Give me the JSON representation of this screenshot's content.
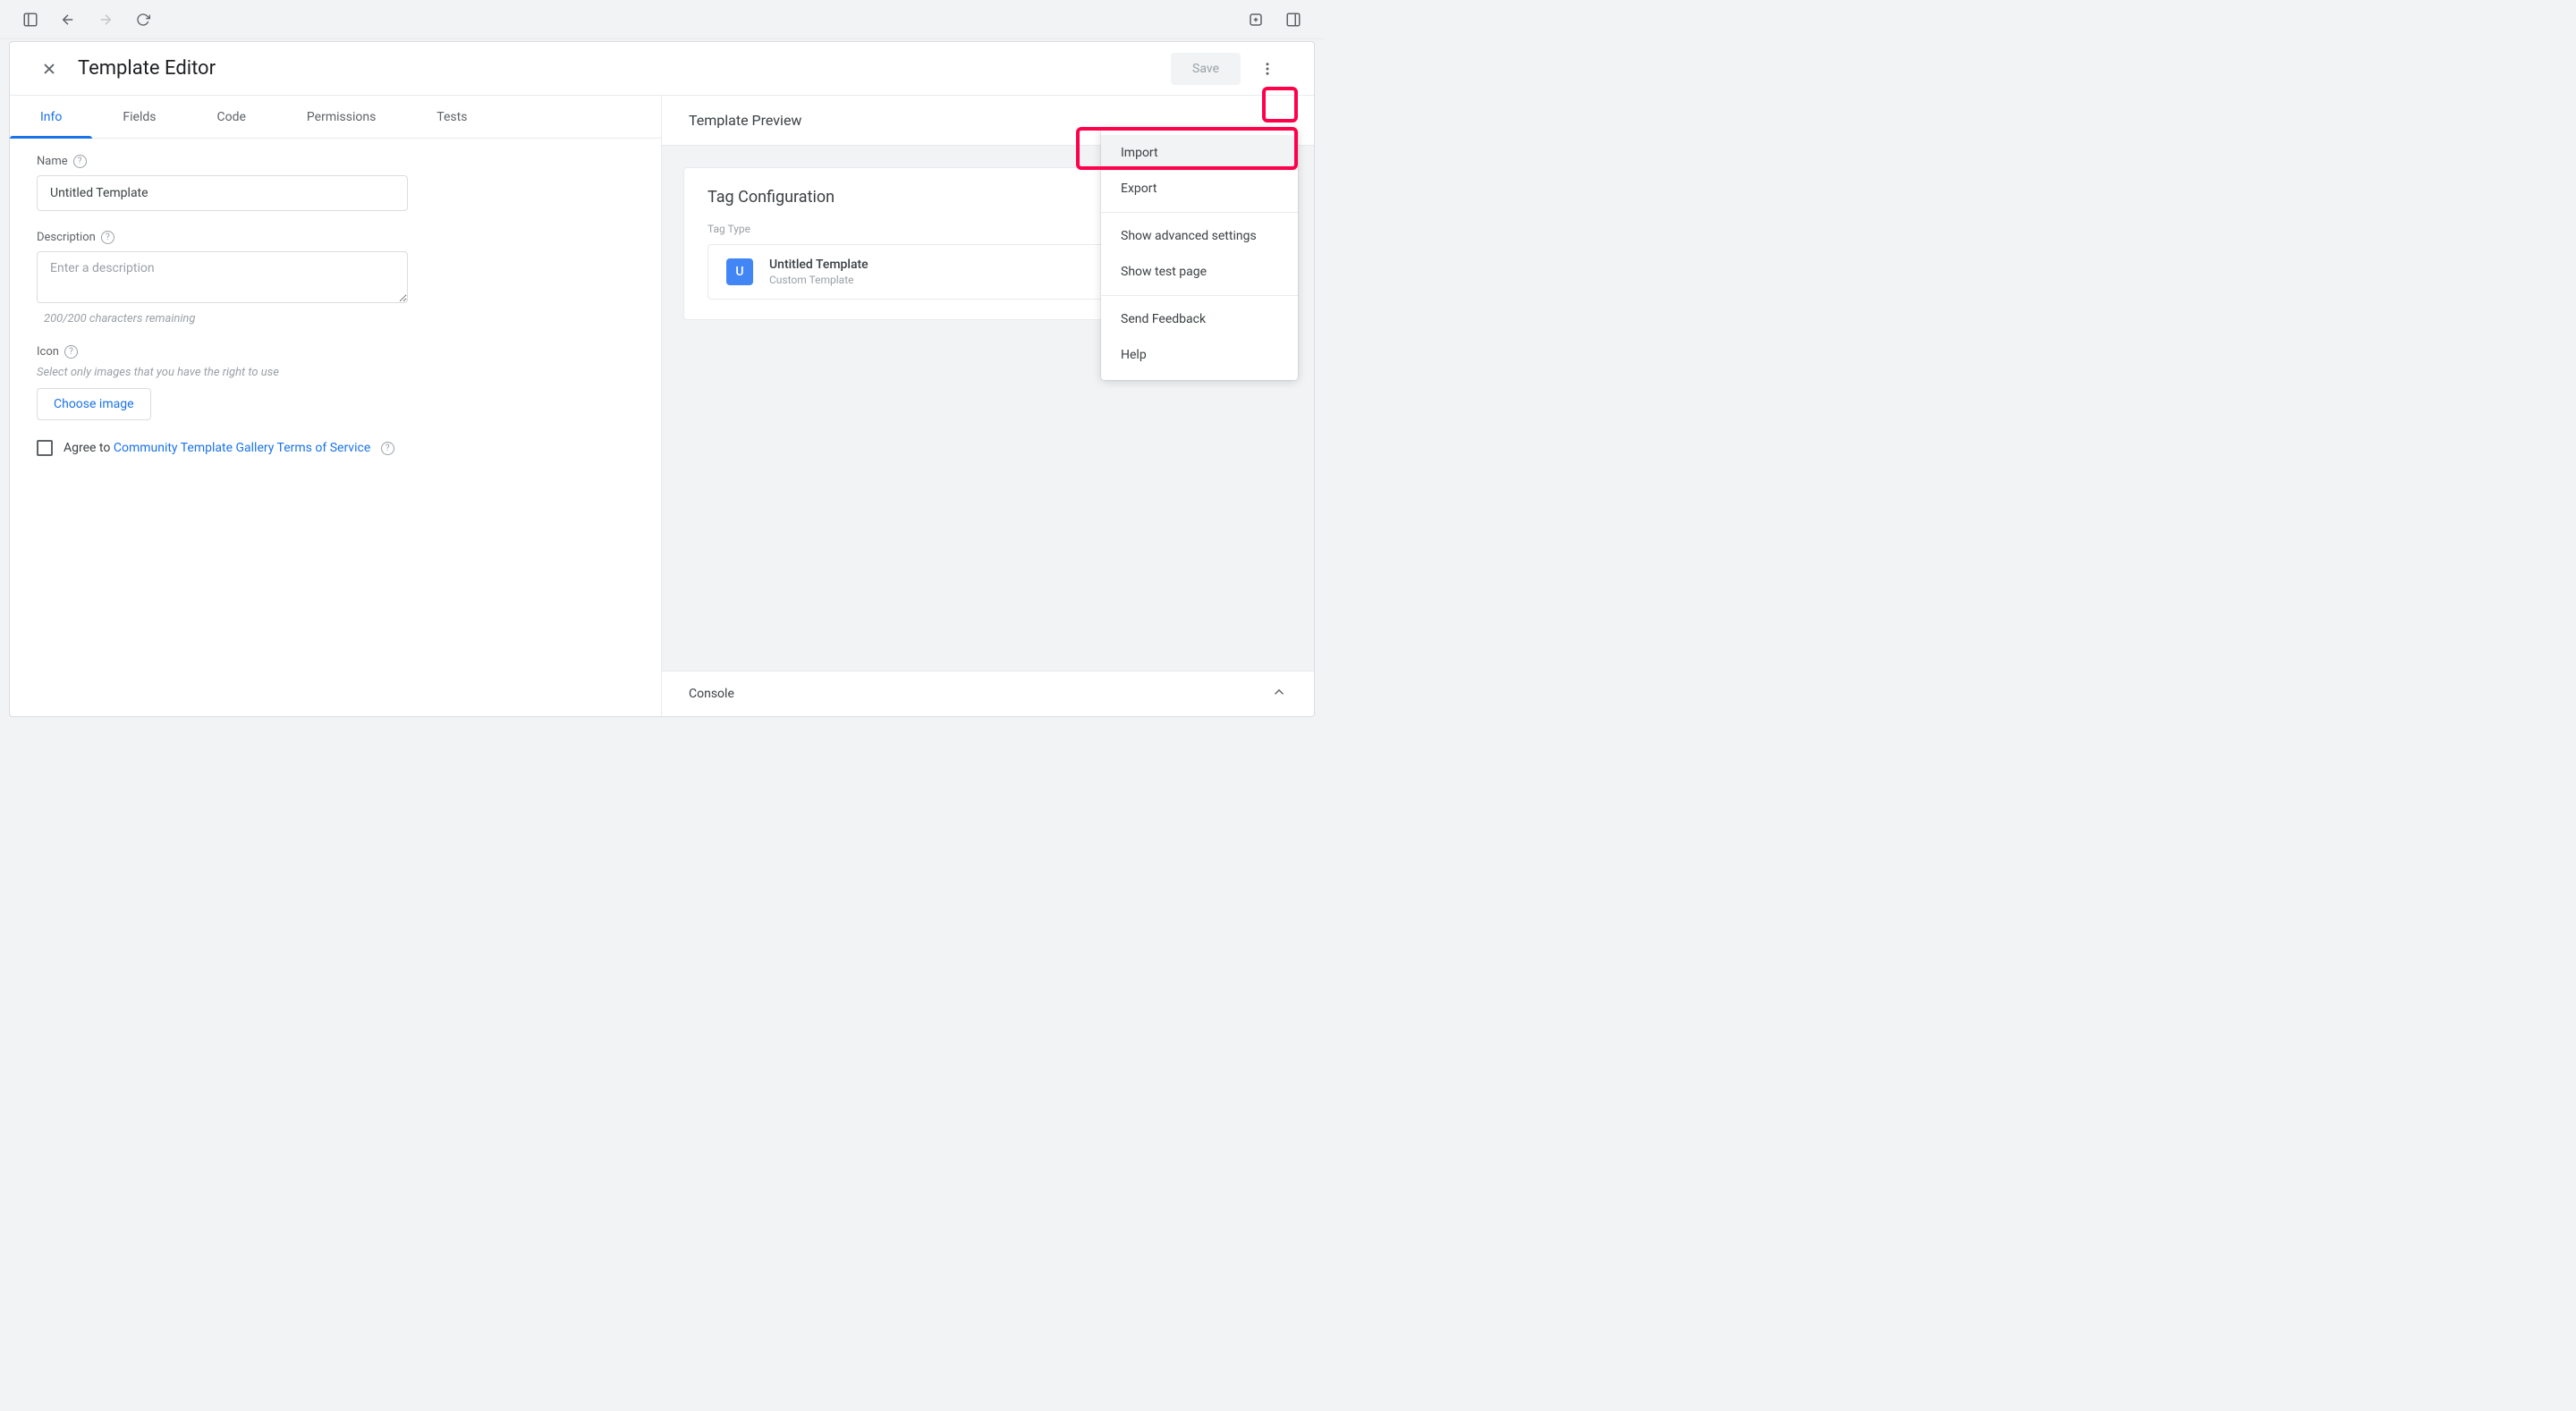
{
  "header": {
    "title": "Template Editor",
    "save_label": "Save"
  },
  "tabs": {
    "info": "Info",
    "fields": "Fields",
    "code": "Code",
    "permissions": "Permissions",
    "tests": "Tests"
  },
  "form": {
    "name_label": "Name",
    "name_value": "Untitled Template",
    "description_label": "Description",
    "description_placeholder": "Enter a description",
    "char_remaining": "200/200 characters remaining",
    "icon_label": "Icon",
    "icon_hint": "Select only images that you have the right to use",
    "choose_image": "Choose image",
    "agree_prefix": "Agree to ",
    "tos_link": "Community Template Gallery Terms of Service"
  },
  "preview": {
    "title": "Template Preview",
    "tag_config": "Tag Configuration",
    "tag_type_label": "Tag Type",
    "template_initial": "U",
    "template_name": "Untitled Template",
    "template_sub": "Custom Template"
  },
  "console": {
    "label": "Console"
  },
  "menu": {
    "import": "Import",
    "export": "Export",
    "advanced": "Show advanced settings",
    "test_page": "Show test page",
    "feedback": "Send Feedback",
    "help": "Help"
  }
}
